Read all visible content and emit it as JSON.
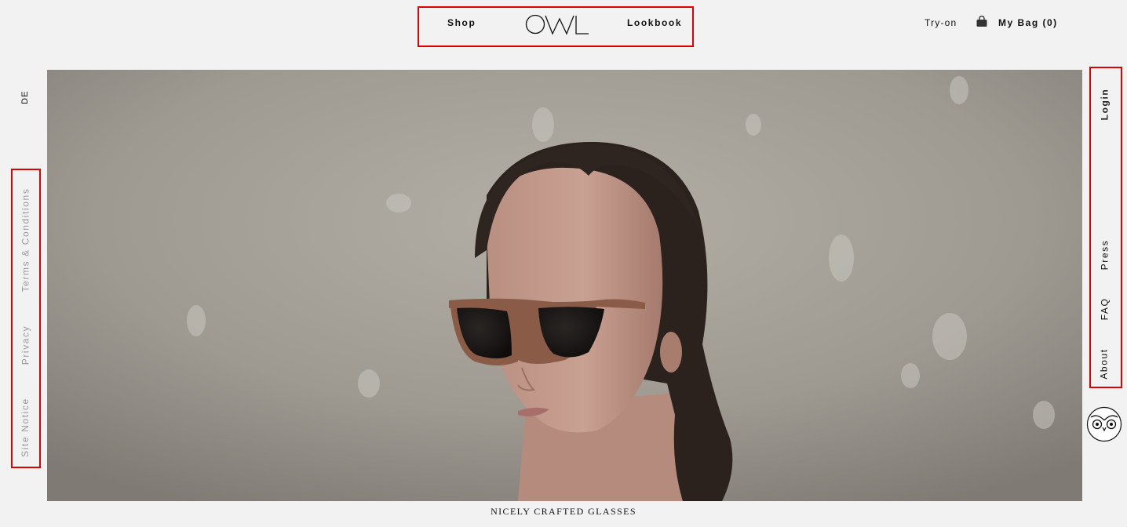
{
  "header": {
    "nav_left": "Shop",
    "logo_text": "OWL",
    "nav_right": "Lookbook",
    "tryon": "Try-on",
    "bag_icon": "shopping-bag-icon",
    "my_bag": "My Bag (0)"
  },
  "left_rail": {
    "language": "DE",
    "links": [
      "Terms & Conditions",
      "Privacy",
      "Site Notice"
    ]
  },
  "right_rail": {
    "links": [
      "Login",
      "Press",
      "FAQ",
      "About"
    ],
    "owl_icon": "owl-face-icon"
  },
  "hero": {
    "caption": "NICELY CRAFTED GLASSES"
  },
  "colors": {
    "background": "#f2f2f2",
    "highlight_box": "#e00000",
    "muted_link": "#9a9a9a"
  }
}
